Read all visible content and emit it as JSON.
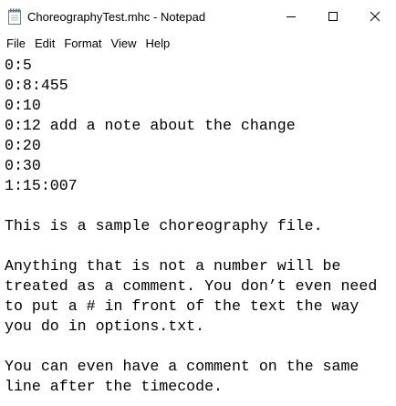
{
  "window": {
    "title": "ChoreographyTest.mhc - Notepad",
    "icon": "notepad-icon"
  },
  "caption_buttons": {
    "minimize": "minimize-icon",
    "maximize": "maximize-icon",
    "close": "close-icon"
  },
  "menu": {
    "items": [
      {
        "label": "File"
      },
      {
        "label": "Edit"
      },
      {
        "label": "Format"
      },
      {
        "label": "View"
      },
      {
        "label": "Help"
      }
    ]
  },
  "editor": {
    "lines": [
      "0:5",
      "0:8:455",
      "0:10",
      "0:12 add a note about the change",
      "0:20",
      "0:30",
      "1:15:007",
      "",
      "This is a sample choreography file.",
      "",
      "Anything that is not a number will be",
      "treated as a comment. You don’t even need",
      "to put a # in front of the text the way",
      "you do in options.txt.",
      "",
      "You can even have a comment on the same",
      "line after the timecode."
    ]
  }
}
